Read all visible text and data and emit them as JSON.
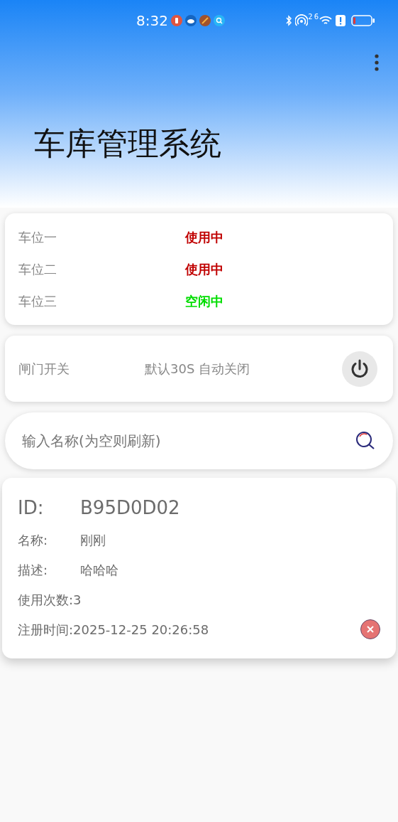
{
  "status_bar": {
    "time": "8:32",
    "signal_labels": [
      "2",
      "6"
    ]
  },
  "app_title": "车库管理系统",
  "parking_spaces": [
    {
      "name": "车位一",
      "status": "使用中",
      "color": "#c00000"
    },
    {
      "name": "车位二",
      "status": "使用中",
      "color": "#c00000"
    },
    {
      "name": "车位三",
      "status": "空闲中",
      "color": "#00dd00"
    }
  ],
  "gate": {
    "label": "闸门开关",
    "hint": "默认30S 自动关闭"
  },
  "search": {
    "placeholder": "输入名称(为空则刷新)"
  },
  "records": [
    {
      "id_label": "ID:",
      "id": "B95D0D02",
      "name_label": "名称:",
      "name": "刚刚",
      "desc_label": "描述:",
      "desc": "哈哈哈",
      "uses": "使用次数:3",
      "registered": "注册时间:2025-12-25 20:26:58"
    }
  ]
}
